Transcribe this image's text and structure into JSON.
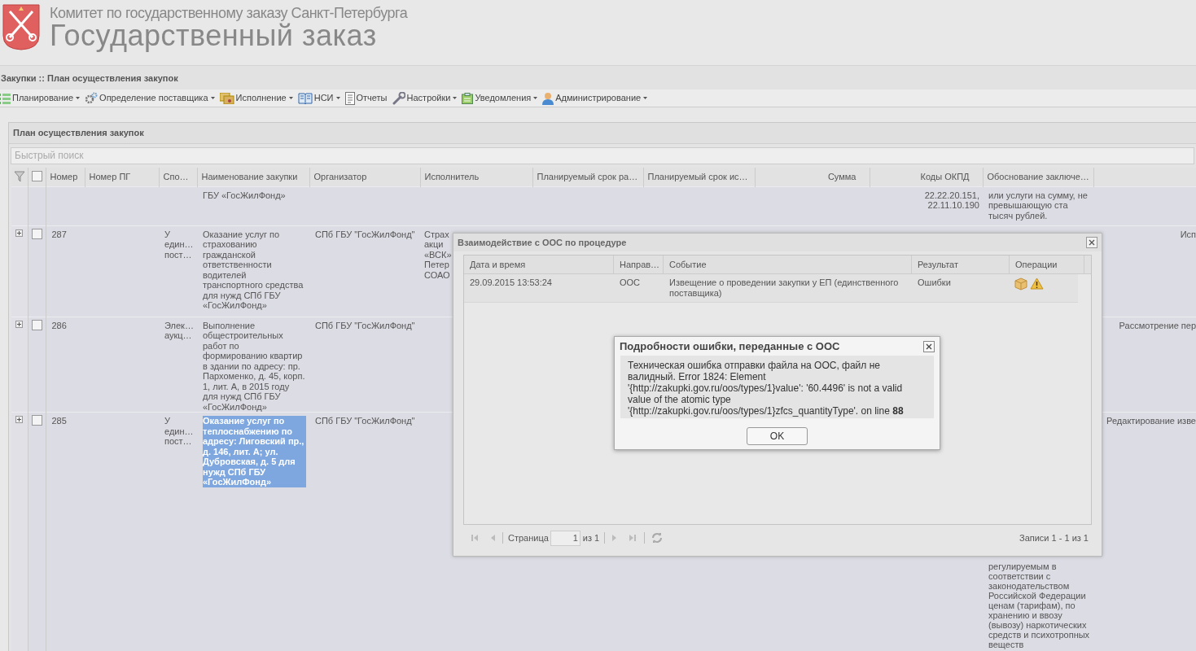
{
  "header": {
    "subtitle": "Комитет по государственному заказу Санкт-Петербурга",
    "title": "Государственный заказ"
  },
  "breadcrumb": "Закупки :: План осуществления закупок",
  "menu": [
    {
      "label": "Планирование",
      "dropdown": true
    },
    {
      "label": "Определение поставщика",
      "dropdown": true
    },
    {
      "label": "Исполнение",
      "dropdown": true
    },
    {
      "label": "НСИ",
      "dropdown": true
    },
    {
      "label": "Отчеты",
      "dropdown": false
    },
    {
      "label": "Настройки",
      "dropdown": true
    },
    {
      "label": "Уведомления",
      "dropdown": true
    },
    {
      "label": "Администрирование",
      "dropdown": true
    }
  ],
  "panel": {
    "title": "План осуществления закупок",
    "search": {
      "placeholder": "Быстрый поиск"
    },
    "grid": {
      "select_all_checked": false,
      "columns": [
        {
          "label": "Номер"
        },
        {
          "label": "Номер ПГ"
        },
        {
          "label": "Спо…"
        },
        {
          "label": "Наименование закупки"
        },
        {
          "label": "Организатор"
        },
        {
          "label": "Исполнитель"
        },
        {
          "label": "Планируемый срок ра…"
        },
        {
          "label": "Планируемый срок ис…"
        },
        {
          "label": "Сумма"
        },
        {
          "label": "Коды ОКПД"
        },
        {
          "label": "Обоснование заключе…"
        }
      ],
      "rows": [
        {
          "kind": "tail",
          "name": "ГБУ «ГосЖилФонд»",
          "okpd": "22.22.20.151,\n22.11.10.190",
          "basis": "или услуги на сумму, не превышающую ста тысяч рублей."
        },
        {
          "kind": "record",
          "checked": false,
          "number": "287",
          "method": "У един… пост…",
          "name": "Оказание услуг по страхованию гражданской ответственности водителей транспортного средства для нужд СПб ГБУ «ГосЖилФонд»",
          "name_highlighted": false,
          "organizer": "СПб ГБУ \"ГосЖилФонд\"",
          "executor": "Страх\nакци\n«ВСК»\nПетер\nСОАО",
          "status": "Исп"
        },
        {
          "kind": "record",
          "checked": false,
          "number": "286",
          "method": "Элек… аукц…",
          "name": "Выполнение общестроительных работ по формированию квартир в здании по адресу: пр. Пархоменко, д. 45, корп. 1, лит. А, в 2015 году для нужд СПб ГБУ «ГосЖилФонд»",
          "name_highlighted": false,
          "organizer": "СПб ГБУ \"ГосЖилФонд\"",
          "status": "Рассмотрение пер"
        },
        {
          "kind": "record",
          "checked": false,
          "number": "285",
          "method": "У един… пост…",
          "name": "Оказание услуг по теплоснабжению по адресу: Лиговский пр., д. 146, лит. А; ул. Дубровская, д. 5 для нужд СПб ГБУ «ГосЖилФонд»",
          "name_highlighted": true,
          "organizer": "СПб ГБУ \"ГосЖилФонд\"",
          "basis": "регулируемым в соответствии с законодательством Российской Федерации ценам (тарифам), по хранению и ввозу (вывозу) наркотических средств и психотропных веществ",
          "status": "Редактирование изве"
        }
      ]
    }
  },
  "interaction_dialog": {
    "title": "Взаимодействие с ООС по процедуре",
    "columns": [
      {
        "label": "Дата и время"
      },
      {
        "label": "Направ…"
      },
      {
        "label": "Событие"
      },
      {
        "label": "Результат"
      },
      {
        "label": "Операции"
      }
    ],
    "rows": [
      {
        "date": "29.09.2015 13:53:24",
        "direction": "ООС",
        "event": "Извещение о проведении закупки у ЕП (единственного поставщика)",
        "result": "Ошибки"
      }
    ],
    "pager": {
      "page_label": "Страница",
      "page": "1",
      "of": "из 1",
      "records": "Записи 1 - 1 из 1"
    }
  },
  "error_dialog": {
    "title": "Подробности ошибки, переданные с ООС",
    "message": "Техническая ошибка отправки файла на ООС, файл не валидный. Error 1824: Element '{http://zakupki.gov.ru/oos/types/1}value': '60.4496' is not a valid value of the atomic type '{http://zakupki.gov.ru/oos/types/1}zfcs_quantityType'. on line **88**",
    "button": "OK"
  }
}
